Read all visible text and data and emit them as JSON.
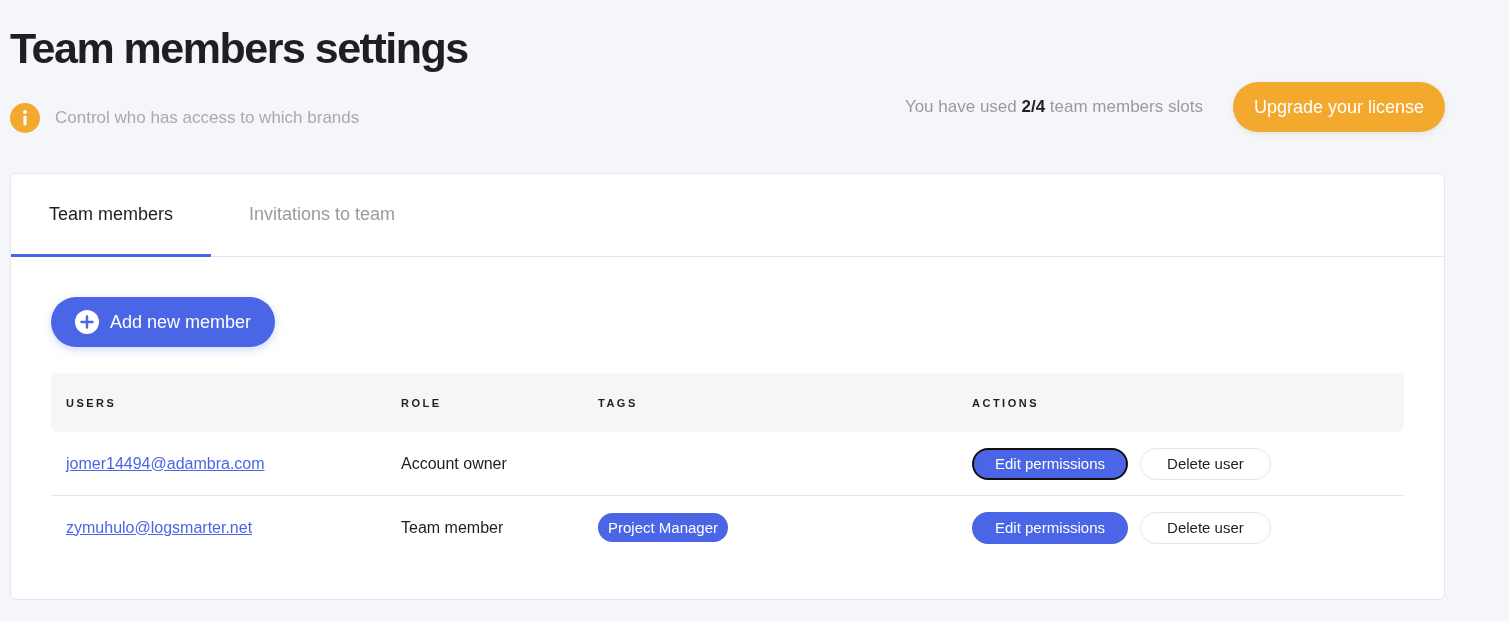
{
  "page": {
    "title": "Team members settings",
    "subtitle": "Control who has access to which brands",
    "usage": "You have used **2/4** team members slots",
    "upgrade_button": "Upgrade your license"
  },
  "tabs": [
    {
      "label": "Team members",
      "selected": true
    },
    {
      "label": "Invitations to team",
      "selected": false
    }
  ],
  "add_button": "Add new member",
  "table": {
    "columns": [
      "USERS",
      "ROLE",
      "TAGS",
      "ACTIONS"
    ],
    "rows": [
      {
        "email": "jomer14494@adambra.com",
        "role": "Account owner",
        "tags": [],
        "actions": [
          {
            "label": "Edit permissions",
            "kind": "primary",
            "focused": true
          },
          {
            "label": "Delete user",
            "kind": "secondary",
            "focused": false
          }
        ]
      },
      {
        "email": "zymuhulo@logsmarter.net",
        "role": "Team member",
        "tags": [
          "Project Manager"
        ],
        "actions": [
          {
            "label": "Edit permissions",
            "kind": "primary",
            "focused": false
          },
          {
            "label": "Delete user",
            "kind": "secondary",
            "focused": false
          }
        ]
      }
    ]
  }
}
